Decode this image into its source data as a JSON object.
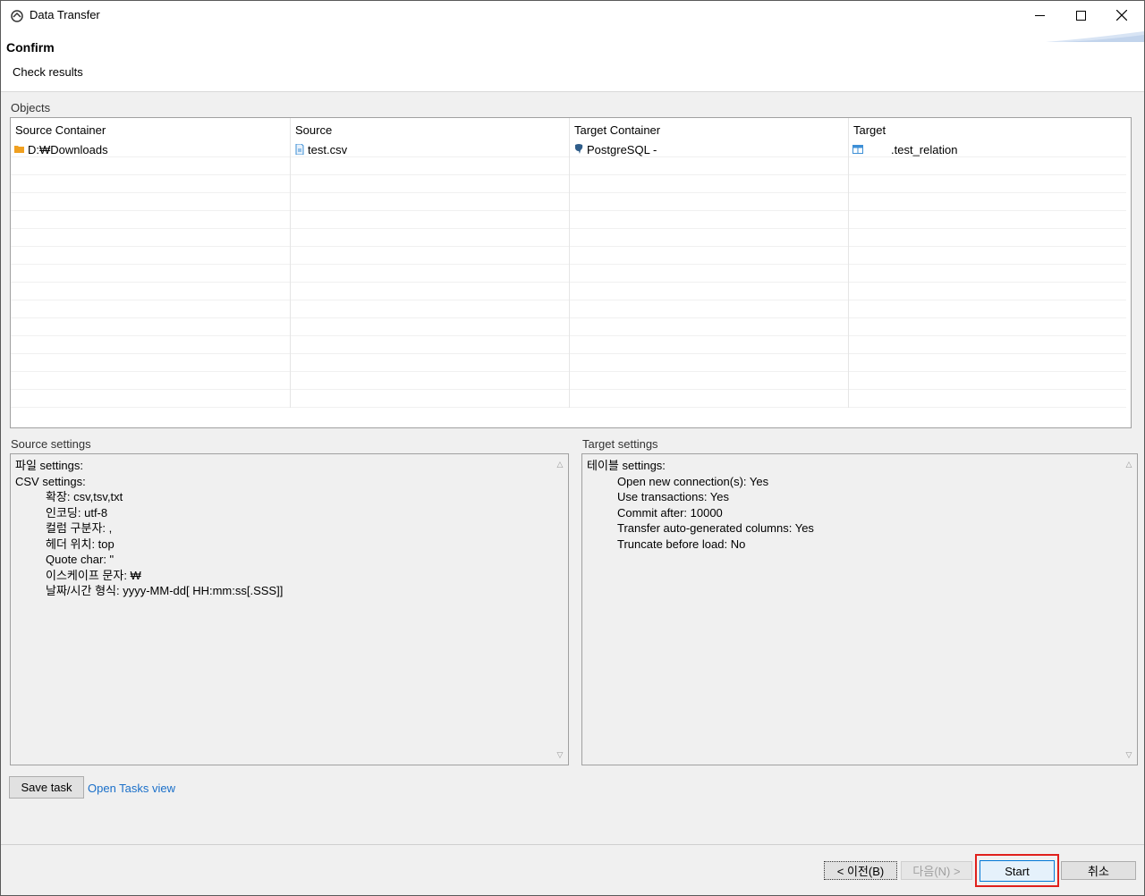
{
  "window": {
    "title": "Data Transfer"
  },
  "header": {
    "title": "Confirm",
    "description": "Check results"
  },
  "objects": {
    "label": "Objects",
    "columns": [
      "Source Container",
      "Source",
      "Target Container",
      "Target"
    ],
    "rows": [
      {
        "source_container": "D:₩Downloads",
        "source": "test.csv",
        "target_container": "PostgreSQL -",
        "target": ".test_relation"
      }
    ]
  },
  "source_settings": {
    "label": "Source settings",
    "lines": [
      {
        "text": "파일 settings:",
        "indent": false
      },
      {
        "text": "CSV settings:",
        "indent": false
      },
      {
        "text": "확장: csv,tsv,txt",
        "indent": true
      },
      {
        "text": "인코딩: utf-8",
        "indent": true
      },
      {
        "text": "컬럼 구분자: ,",
        "indent": true
      },
      {
        "text": "헤더 위치: top",
        "indent": true
      },
      {
        "text": "Quote char: \"",
        "indent": true
      },
      {
        "text": "이스케이프 문자: ₩",
        "indent": true
      },
      {
        "text": "날짜/시간 형식: yyyy-MM-dd[ HH:mm:ss[.SSS]]",
        "indent": true
      }
    ]
  },
  "target_settings": {
    "label": "Target settings",
    "lines": [
      {
        "text": "테이블 settings:",
        "indent": false
      },
      {
        "text": "Open new connection(s): Yes",
        "indent": true
      },
      {
        "text": "Use transactions: Yes",
        "indent": true
      },
      {
        "text": "Commit after: 10000",
        "indent": true
      },
      {
        "text": "Transfer auto-generated columns: Yes",
        "indent": true
      },
      {
        "text": "Truncate before load: No",
        "indent": true
      }
    ]
  },
  "actions": {
    "save_task": "Save task",
    "open_tasks_view": "Open Tasks view",
    "back": "< 이전(B)",
    "next": "다음(N) >",
    "start": "Start",
    "cancel": "취소"
  },
  "colors": {
    "highlight": "#e0201c",
    "link": "#1a6fc9",
    "folder": "#f0a020",
    "file": "#3d8fd6"
  }
}
